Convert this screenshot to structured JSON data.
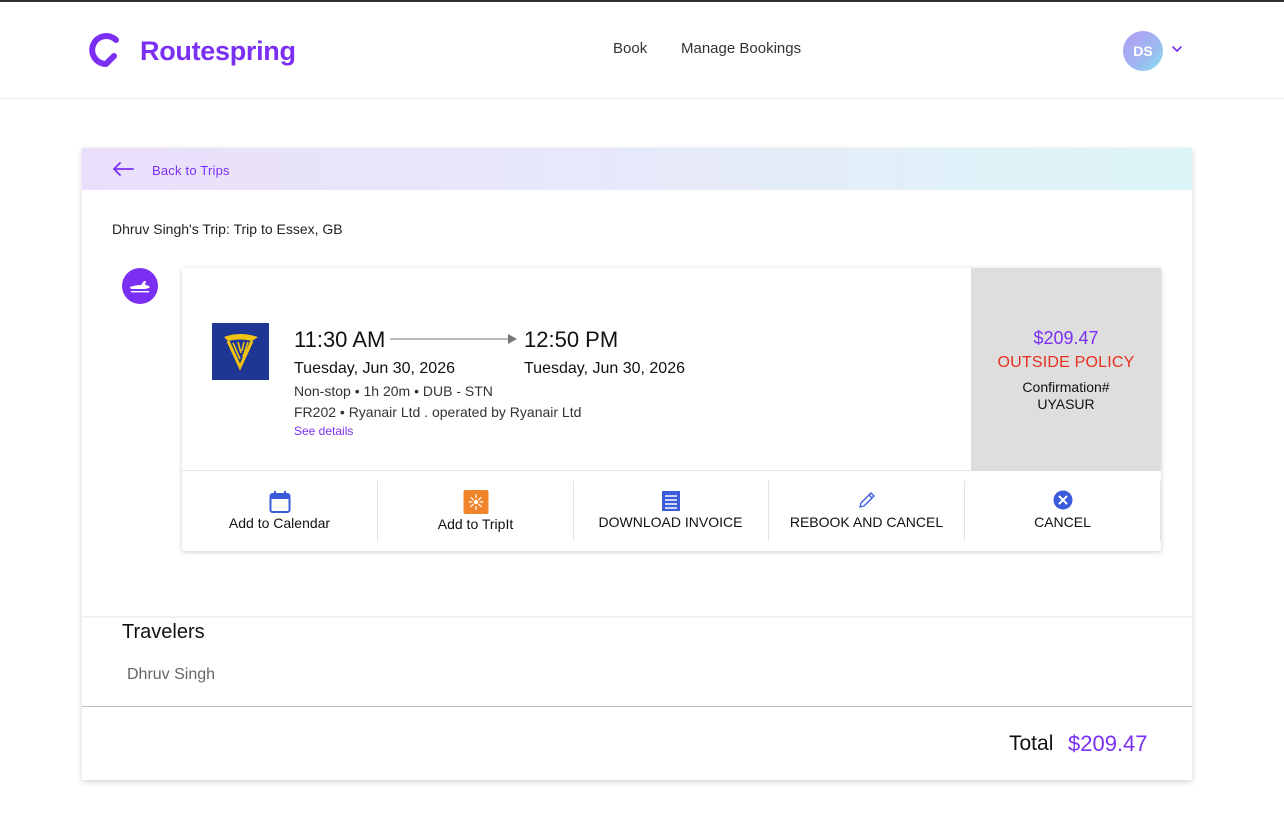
{
  "brand": {
    "name": "Routespring",
    "accent": "#7b2ff2"
  },
  "nav": {
    "book": "Book",
    "manage": "Manage Bookings"
  },
  "user": {
    "initials": "DS"
  },
  "back": {
    "label": "Back to Trips"
  },
  "trip": {
    "title": "Dhruv Singh's Trip: Trip to Essex, GB"
  },
  "flight": {
    "departure_time": "11:30 AM",
    "departure_date": "Tuesday, Jun 30, 2026",
    "arrival_time": "12:50 PM",
    "arrival_date": "Tuesday, Jun 30, 2026",
    "meta": "Non-stop • 1h 20m • DUB - STN",
    "flight_info": "FR202 • Ryanair Ltd . operated by Ryanair Ltd",
    "details_link": "See details",
    "price": "$209.47",
    "policy": "OUTSIDE POLICY",
    "confirmation_label": "Confirmation#",
    "confirmation_code": "UYASUR",
    "policy_color": "#e8301e"
  },
  "actions": {
    "calendar": "Add to Calendar",
    "tripit": "Add to TripIt",
    "invoice": "DOWNLOAD INVOICE",
    "rebook": "REBOOK AND CANCEL",
    "cancel": "CANCEL"
  },
  "travelers": {
    "title": "Travelers",
    "names": [
      "Dhruv Singh"
    ]
  },
  "total": {
    "label": "Total",
    "value": "$209.47"
  }
}
